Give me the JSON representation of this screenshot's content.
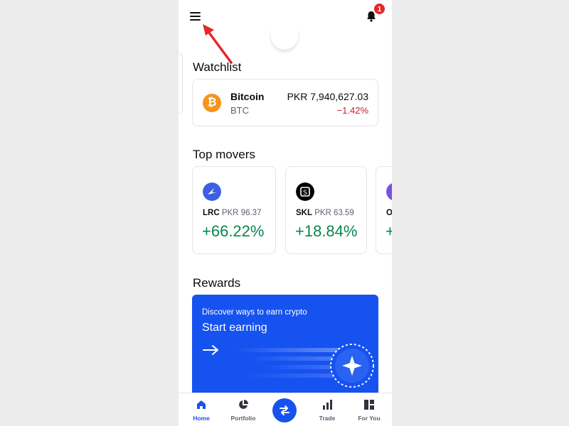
{
  "header": {
    "notification_count": "1"
  },
  "watchlist": {
    "title": "Watchlist",
    "items": [
      {
        "name": "Bitcoin",
        "ticker": "BTC",
        "price": "PKR 7,940,627.03",
        "change": "−1.42%",
        "logo_color": "#f7931a",
        "logo_glyph": "₿"
      }
    ]
  },
  "top_movers": {
    "title": "Top movers",
    "items": [
      {
        "symbol": "LRC",
        "price": "PKR 96.37",
        "change": "+66.22%",
        "logo_color": "#3d5fe0",
        "logo_icon": "loopring-icon"
      },
      {
        "symbol": "SKL",
        "price": "PKR 63.59",
        "change": "+18.84%",
        "logo_color": "#000000",
        "logo_icon": "skale-icon"
      },
      {
        "symbol": "O",
        "price": "",
        "change": "+",
        "logo_color": "#7b4fe0",
        "logo_icon": "coin-icon"
      }
    ]
  },
  "rewards": {
    "title": "Rewards",
    "subtitle": "Discover ways to earn crypto",
    "cta": "Start earning",
    "bg_color": "#1652f0"
  },
  "tabs": [
    {
      "label": "Home",
      "icon": "home-icon",
      "active": true
    },
    {
      "label": "Portfolio",
      "icon": "pie-chart-icon",
      "active": false
    },
    {
      "label": "",
      "icon": "swap-icon",
      "active": false
    },
    {
      "label": "Trade",
      "icon": "bar-chart-icon",
      "active": false
    },
    {
      "label": "For You",
      "icon": "grid-icon",
      "active": false
    }
  ],
  "colors": {
    "accent": "#1652f0",
    "positive": "#098551",
    "negative": "#cf202f",
    "annotation": "#e8262a"
  }
}
